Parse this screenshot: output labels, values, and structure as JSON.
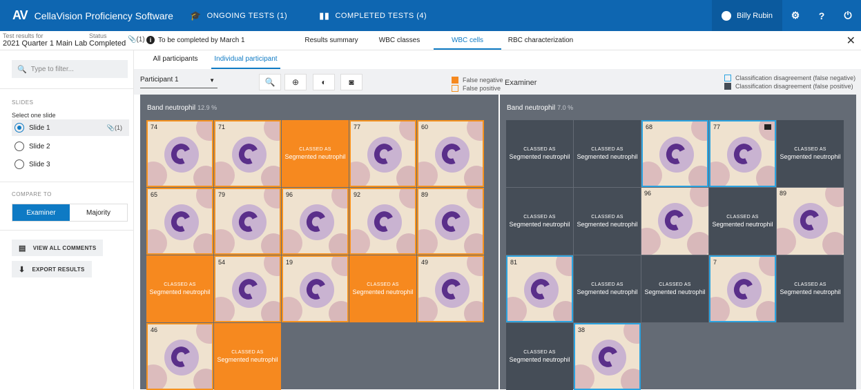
{
  "app": {
    "logo": "AV",
    "name": "CellaVision Proficiency Software"
  },
  "nav": {
    "ongoing": "ONGOING TESTS (1)",
    "completed": "COMPLETED TESTS (4)"
  },
  "user": {
    "name": "Billy Rubin"
  },
  "header": {
    "test_results_label": "Test results for",
    "test_results_value": "2021 Quarter 1 Main Lab",
    "status_label": "Status",
    "status_value": "Completed",
    "attachments": "(1)",
    "due": "To be completed by March 1",
    "tabs": [
      "Results summary",
      "WBC classes",
      "WBC cells",
      "RBC characterization"
    ]
  },
  "sidebar": {
    "filter_placeholder": "Type to filter...",
    "slides_heading": "SLIDES",
    "select_label": "Select one slide",
    "slides": [
      {
        "label": "Slide 1",
        "attachments": "(1)",
        "selected": true
      },
      {
        "label": "Slide 2",
        "selected": false
      },
      {
        "label": "Slide 3",
        "selected": false
      }
    ],
    "compare_heading": "COMPARE TO",
    "compare_options": [
      "Examiner",
      "Majority"
    ],
    "compare_selected": "Examiner",
    "view_comments": "VIEW ALL COMMENTS",
    "export": "EXPORT RESULTS"
  },
  "subtabs": [
    "All participants",
    "Individual participant"
  ],
  "toolbar": {
    "participant": "Participant 1",
    "legend_false_negative": "False negative",
    "legend_false_positive": "False positive",
    "examiner_label": "Examiner",
    "legend_disagree_fn": "Classification disagreement (false negative)",
    "legend_disagree_fp": "Classification disagreement (false positive)"
  },
  "colors": {
    "accent": "#0e7ac4",
    "orange": "#f6891f",
    "dark_tile": "#454d57",
    "panel": "#646b75"
  },
  "left_panel": {
    "title": "Band neutrophil",
    "percent": "12.9 %",
    "tiles": [
      {
        "type": "img",
        "num": "74"
      },
      {
        "type": "img",
        "num": "71"
      },
      {
        "type": "classed",
        "small": "CLASSED AS",
        "big": "Segmented neutrophil"
      },
      {
        "type": "img",
        "num": "77"
      },
      {
        "type": "img",
        "num": "60"
      },
      {
        "type": "img",
        "num": "65"
      },
      {
        "type": "img",
        "num": "79"
      },
      {
        "type": "img",
        "num": "96"
      },
      {
        "type": "img",
        "num": "92"
      },
      {
        "type": "img",
        "num": "89"
      },
      {
        "type": "classed",
        "small": "CLASSED AS",
        "big": "Segmented neutrophil"
      },
      {
        "type": "img",
        "num": "54"
      },
      {
        "type": "img",
        "num": "19"
      },
      {
        "type": "classed",
        "small": "CLASSED AS",
        "big": "Segmented neutrophil"
      },
      {
        "type": "img",
        "num": "49"
      },
      {
        "type": "img",
        "num": "46"
      },
      {
        "type": "classed",
        "small": "CLASSED AS",
        "big": "Segmented neutrophil"
      }
    ]
  },
  "right_panel": {
    "title": "Band neutrophil",
    "percent": "7.0 %",
    "tiles": [
      {
        "type": "classed",
        "small": "CLASSED AS",
        "big": "Segmented neutrophil"
      },
      {
        "type": "classed",
        "small": "CLASSED AS",
        "big": "Segmented neutrophil"
      },
      {
        "type": "img",
        "num": "68"
      },
      {
        "type": "img",
        "num": "77"
      },
      {
        "type": "classed",
        "small": "CLASSED AS",
        "big": "Segmented neutrophil"
      },
      {
        "type": "classed",
        "small": "CLASSED AS",
        "big": "Segmented neutrophil"
      },
      {
        "type": "classed",
        "small": "CLASSED AS",
        "big": "Segmented neutrophil"
      },
      {
        "type": "img",
        "num": "96"
      },
      {
        "type": "classed",
        "small": "CLASSED AS",
        "big": "Segmented neutrophil"
      },
      {
        "type": "img",
        "num": "89"
      },
      {
        "type": "img",
        "num": "81"
      },
      {
        "type": "classed",
        "small": "CLASSED AS",
        "big": "Segmented neutrophil"
      },
      {
        "type": "classed",
        "small": "CLASSED AS",
        "big": "Segmented neutrophil"
      },
      {
        "type": "img",
        "num": "7"
      },
      {
        "type": "classed",
        "small": "CLASSED AS",
        "big": "Segmented neutrophil"
      },
      {
        "type": "classed",
        "small": "CLASSED AS",
        "big": "Segmented neutrophil"
      },
      {
        "type": "img",
        "num": "38"
      }
    ]
  }
}
